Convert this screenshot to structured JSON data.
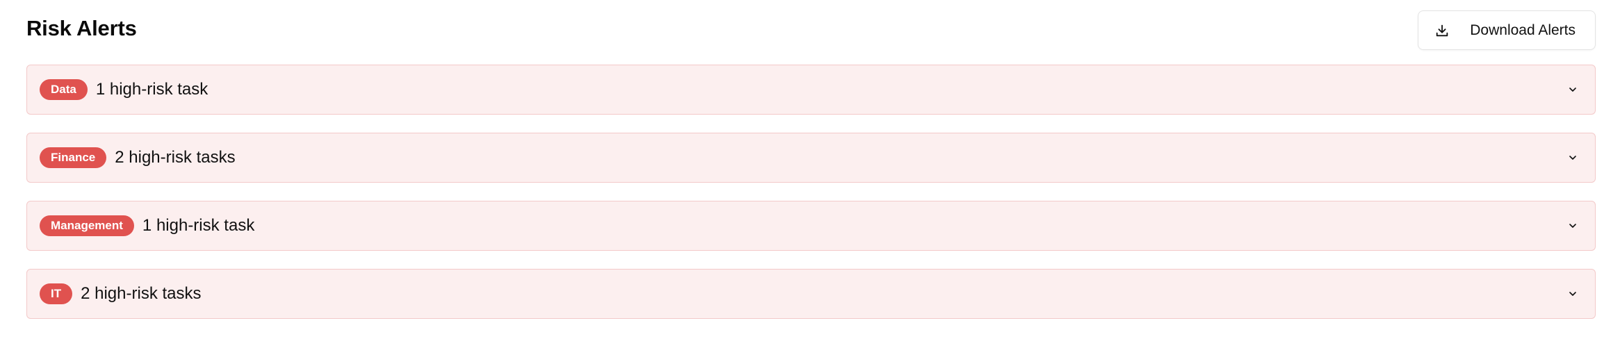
{
  "header": {
    "title": "Risk Alerts",
    "download_label": "Download Alerts",
    "download_icon": "download-icon"
  },
  "alerts": [
    {
      "category": "Data",
      "summary": "1 high-risk task",
      "expand_icon": "chevron-down-icon"
    },
    {
      "category": "Finance",
      "summary": "2 high-risk tasks",
      "expand_icon": "chevron-down-icon"
    },
    {
      "category": "Management",
      "summary": "1 high-risk task",
      "expand_icon": "chevron-down-icon"
    },
    {
      "category": "IT",
      "summary": "2 high-risk tasks",
      "expand_icon": "chevron-down-icon"
    }
  ],
  "colors": {
    "badge": "#e0524f",
    "row_background": "#fcefef",
    "row_border": "#f3c9c9"
  }
}
